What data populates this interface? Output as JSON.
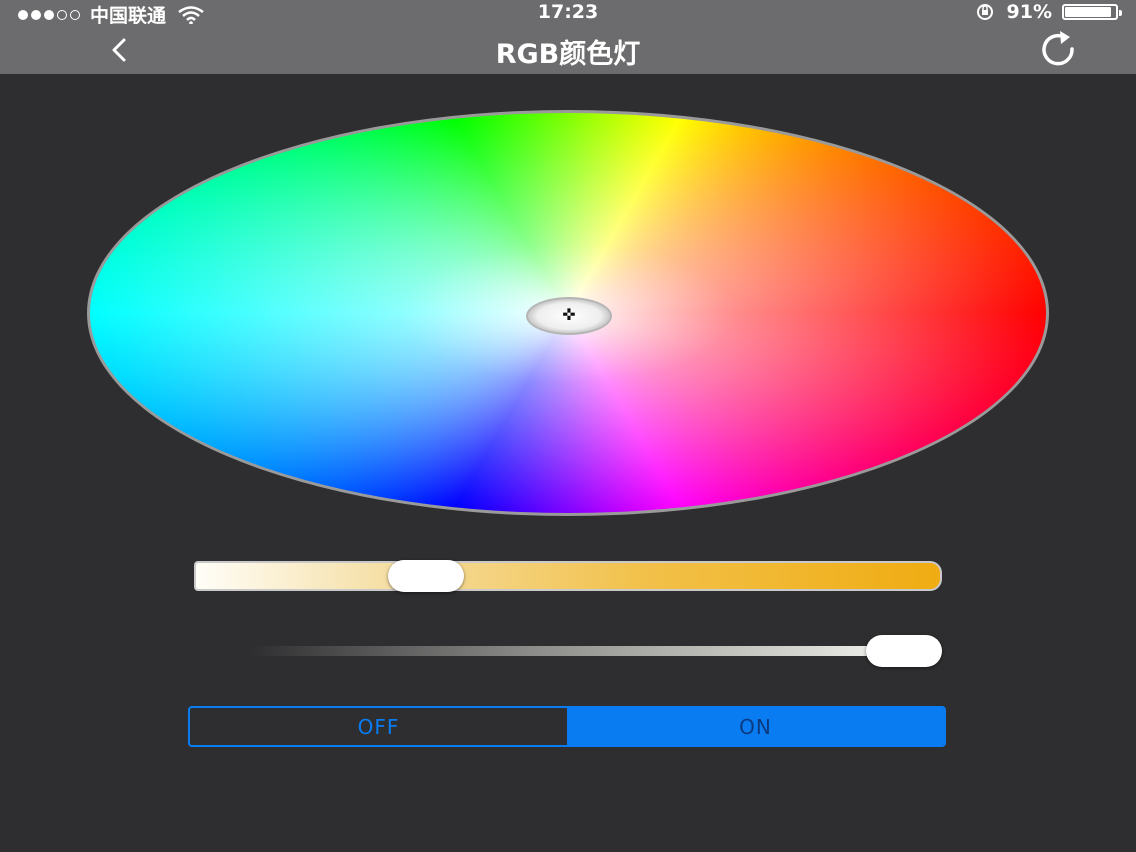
{
  "status_bar": {
    "signal_dots_filled": 3,
    "signal_dots_total": 5,
    "carrier": "中国联通",
    "time": "17:23",
    "battery_percent": "91%",
    "battery_level": 0.91,
    "icons": [
      "wifi-icon",
      "orientation-lock-icon",
      "battery-icon"
    ]
  },
  "nav": {
    "title": "RGB颜色灯",
    "back_icon": "chevron-left-icon",
    "refresh_icon": "refresh-icon"
  },
  "color_wheel": {
    "selected_color": "#ffffff",
    "hue_order": [
      "red",
      "magenta",
      "blue",
      "cyan",
      "green",
      "yellow"
    ]
  },
  "warmth_slider": {
    "value": 0.31,
    "gradient_start": "#fffef8",
    "gradient_end": "#f0ac12"
  },
  "brightness_slider": {
    "value": 1.0
  },
  "power_toggle": {
    "off_label": "OFF",
    "on_label": "ON",
    "selected": "ON",
    "accent": "#0a7cf2"
  }
}
